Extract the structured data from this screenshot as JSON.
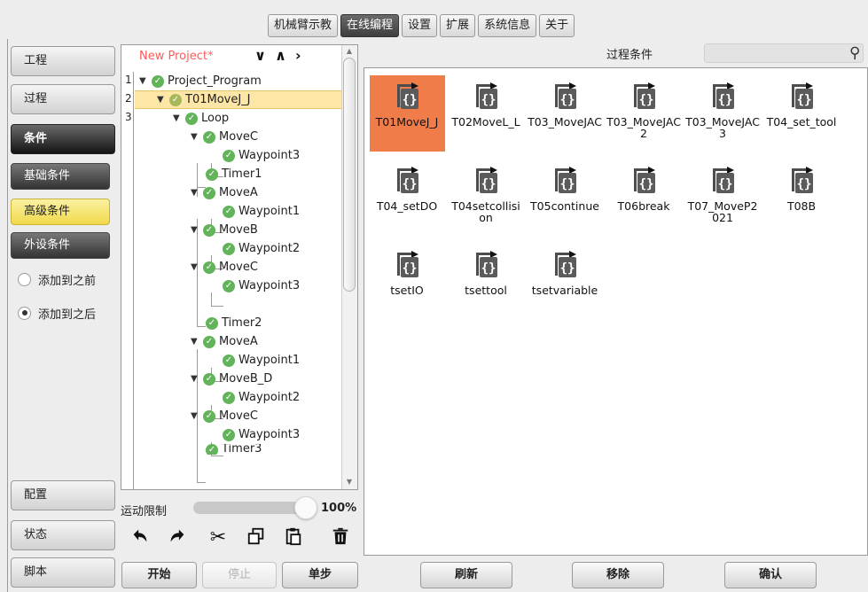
{
  "top_menu": [
    {
      "label": "机械臂示教",
      "active": false
    },
    {
      "label": "在线编程",
      "active": true
    },
    {
      "label": "设置",
      "active": false
    },
    {
      "label": "扩展",
      "active": false
    },
    {
      "label": "系统信息",
      "active": false
    },
    {
      "label": "关于",
      "active": false
    }
  ],
  "sidebar": {
    "project": "工程",
    "process": "过程",
    "condition": "条件",
    "basic_condition": "基础条件",
    "advanced_condition": "高级条件",
    "peripheral_condition": "外设条件",
    "add_before": "添加到之前",
    "add_after": "添加到之后",
    "add_after_checked": true,
    "config": "配置",
    "status": "状态",
    "script": "脚本"
  },
  "tree": {
    "project_name": "New Project*",
    "line_numbers": [
      "1",
      "2",
      "3"
    ],
    "nodes": [
      {
        "label": "Project_Program"
      },
      {
        "label": "T01MoveJ_J"
      },
      {
        "label": "Loop"
      },
      {
        "label": "MoveC"
      },
      {
        "label": "Waypoint3"
      },
      {
        "label": "Timer1"
      },
      {
        "label": "MoveA"
      },
      {
        "label": "Waypoint1"
      },
      {
        "label": "MoveB"
      },
      {
        "label": "Waypoint2"
      },
      {
        "label": "MoveC"
      },
      {
        "label": "Waypoint3"
      },
      {
        "label": "Timer2"
      },
      {
        "label": "MoveA"
      },
      {
        "label": "Waypoint1"
      },
      {
        "label": "MoveB_D"
      },
      {
        "label": "Waypoint2"
      },
      {
        "label": "MoveC"
      },
      {
        "label": "Waypoint3"
      },
      {
        "label": "Timer3"
      }
    ],
    "selected_index": 1
  },
  "speed": {
    "label": "运动限制",
    "value": "100%",
    "fraction": 1.0
  },
  "toolbar": {
    "undo": "undo-icon",
    "redo": "redo-icon",
    "cut": "scissors-icon",
    "copy": "copy-icon",
    "paste": "paste-icon",
    "delete": "trash-icon"
  },
  "bottom_buttons": {
    "start": "开始",
    "stop": "停止",
    "step": "单步",
    "refresh": "刷新",
    "remove": "移除",
    "confirm": "确认"
  },
  "right_panel": {
    "title": "过程条件",
    "search_placeholder": "",
    "conditions": [
      {
        "label": "T01MoveJ_J",
        "selected": true
      },
      {
        "label": "T02MoveL_L",
        "selected": false
      },
      {
        "label": "T03_MoveJAC",
        "selected": false
      },
      {
        "label": "T03_MoveJAC2",
        "selected": false
      },
      {
        "label": "T03_MoveJAC3",
        "selected": false
      },
      {
        "label": "T04_set_tool",
        "selected": false
      },
      {
        "label": "T04_setDO",
        "selected": false
      },
      {
        "label": "T04setcollision",
        "selected": false
      },
      {
        "label": "T05continue",
        "selected": false
      },
      {
        "label": "T06break",
        "selected": false
      },
      {
        "label": "T07_MoveP2021",
        "selected": false
      },
      {
        "label": "T08B",
        "selected": false
      },
      {
        "label": "tsetIO",
        "selected": false
      },
      {
        "label": "tsettool",
        "selected": false
      },
      {
        "label": "tsetvariable",
        "selected": false
      }
    ]
  }
}
